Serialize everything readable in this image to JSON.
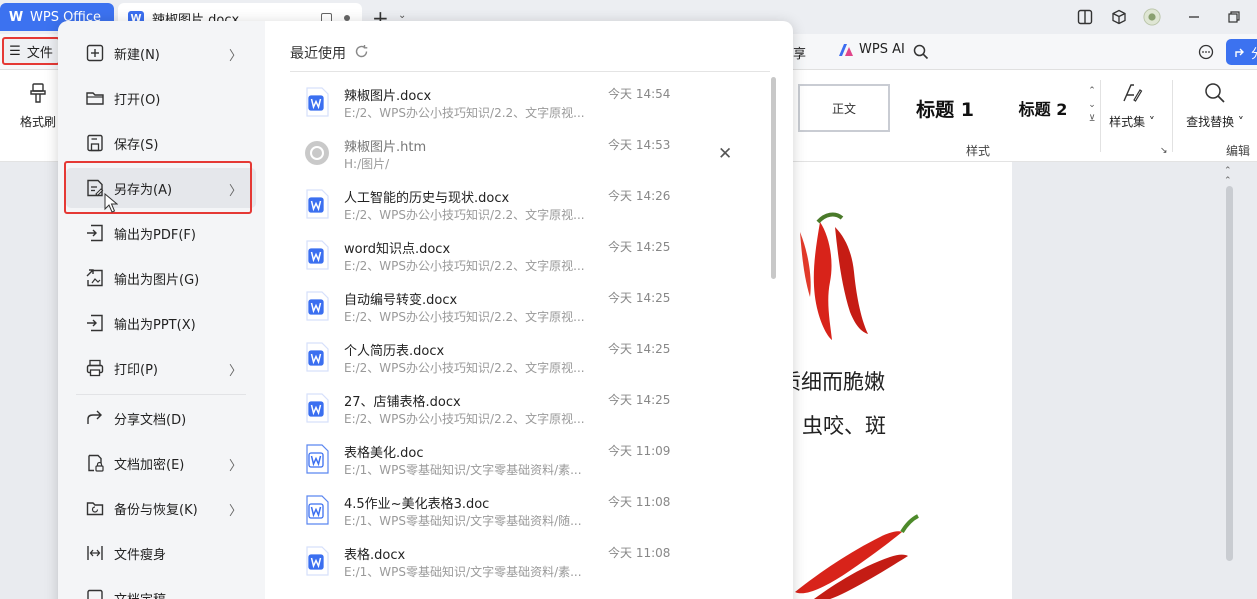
{
  "titlebar": {
    "app_name": "WPS Office",
    "doc_tab_name": "辣椒图片.docx",
    "new_tab": "+",
    "new_tab_caret": "⌄"
  },
  "menubar": {
    "file_label": "文件",
    "share_label": "享",
    "wps_ai_label": "WPS AI",
    "share_button_label": "分"
  },
  "ribbon": {
    "format_painter_label": "格式刷",
    "style_normal": "正文",
    "style_h1": "标题 1",
    "style_h2": "标题 2",
    "style_set_label": "样式集",
    "find_replace_label": "查找替换",
    "group_styles": "样式",
    "group_edit": "编辑"
  },
  "document": {
    "line1": "质细而脆嫩",
    "line2": "虫咬、斑"
  },
  "file_menu": {
    "items": [
      {
        "label": "新建(N)",
        "icon": "new-doc-icon",
        "has_submenu": true
      },
      {
        "label": "打开(O)",
        "icon": "folder-open-icon",
        "has_submenu": false
      },
      {
        "label": "保存(S)",
        "icon": "save-icon",
        "has_submenu": false
      },
      {
        "label": "另存为(A)",
        "icon": "save-as-icon",
        "has_submenu": true
      },
      {
        "label": "输出为PDF(F)",
        "icon": "export-pdf-icon",
        "has_submenu": false
      },
      {
        "label": "输出为图片(G)",
        "icon": "export-image-icon",
        "has_submenu": false
      },
      {
        "label": "输出为PPT(X)",
        "icon": "export-ppt-icon",
        "has_submenu": false
      },
      {
        "label": "打印(P)",
        "icon": "print-icon",
        "has_submenu": true
      },
      {
        "label": "分享文档(D)",
        "icon": "share-icon",
        "has_submenu": false
      },
      {
        "label": "文档加密(E)",
        "icon": "encrypt-icon",
        "has_submenu": true
      },
      {
        "label": "备份与恢复(K)",
        "icon": "backup-icon",
        "has_submenu": true
      },
      {
        "label": "文件瘦身",
        "icon": "slim-icon",
        "has_submenu": false
      },
      {
        "label": "文档定稿",
        "icon": "finalize-icon",
        "has_submenu": false
      }
    ],
    "recent_title": "最近使用",
    "recent_files": [
      {
        "name": "辣椒图片.docx",
        "path": "E:/2、WPS办公小技巧知识/2.2、文字原视...",
        "time": "今天 14:54",
        "type": "docx"
      },
      {
        "name": "辣椒图片.htm",
        "path": "H:/图片/",
        "time": "今天 14:53",
        "type": "htm"
      },
      {
        "name": "人工智能的历史与现状.docx",
        "path": "E:/2、WPS办公小技巧知识/2.2、文字原视...",
        "time": "今天 14:26",
        "type": "docx"
      },
      {
        "name": "word知识点.docx",
        "path": "E:/2、WPS办公小技巧知识/2.2、文字原视...",
        "time": "今天 14:25",
        "type": "docx"
      },
      {
        "name": "自动编号转变.docx",
        "path": "E:/2、WPS办公小技巧知识/2.2、文字原视...",
        "time": "今天 14:25",
        "type": "docx"
      },
      {
        "name": "个人简历表.docx",
        "path": "E:/2、WPS办公小技巧知识/2.2、文字原视...",
        "time": "今天 14:25",
        "type": "docx"
      },
      {
        "name": "27、店铺表格.docx",
        "path": "E:/2、WPS办公小技巧知识/2.2、文字原视...",
        "time": "今天 14:25",
        "type": "docx"
      },
      {
        "name": "表格美化.doc",
        "path": "E:/1、WPS零基础知识/文字零基础资料/素...",
        "time": "今天 11:09",
        "type": "doc"
      },
      {
        "name": "4.5作业~美化表格3.doc",
        "path": "E:/1、WPS零基础知识/文字零基础资料/随...",
        "time": "今天 11:08",
        "type": "doc"
      },
      {
        "name": "表格.docx",
        "path": "E:/1、WPS零基础知识/文字零基础资料/素...",
        "time": "今天 11:08",
        "type": "docx"
      }
    ]
  }
}
